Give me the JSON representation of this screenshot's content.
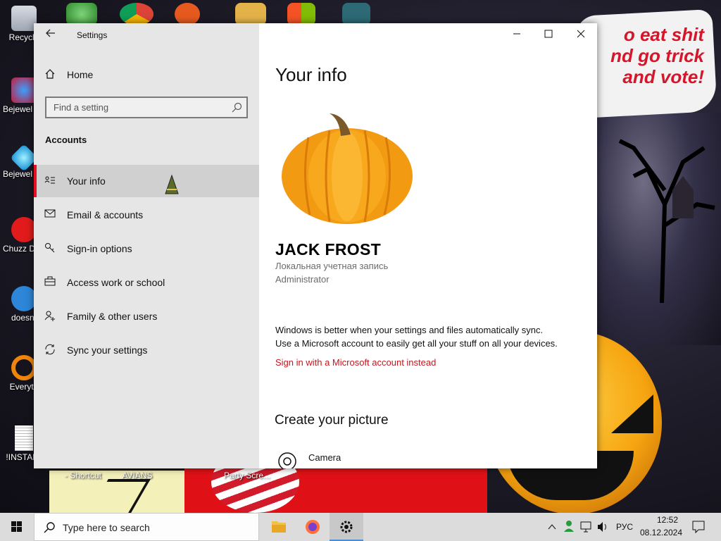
{
  "desktop": {
    "wallpaper_text": [
      "o eat shit",
      "nd go trick",
      "and vote!"
    ],
    "icons": [
      {
        "label": "Recycle"
      },
      {
        "label": "Bejewel Delux"
      },
      {
        "label": "Bejewel Delux"
      },
      {
        "label": "Chuzz Delux"
      },
      {
        "label": "doesnt"
      },
      {
        "label": "Everyth"
      },
      {
        "label": "!INSTALL"
      }
    ],
    "bottom_labels": [
      "- Shortcut",
      "AVIANS",
      "Party Scre..."
    ]
  },
  "window": {
    "title": "Settings",
    "nav": {
      "home_label": "Home",
      "search_placeholder": "Find a setting",
      "section_label": "Accounts",
      "items": [
        {
          "label": "Your info",
          "icon": "person-card-icon",
          "active": true
        },
        {
          "label": "Email & accounts",
          "icon": "mail-icon",
          "active": false
        },
        {
          "label": "Sign-in options",
          "icon": "key-icon",
          "active": false
        },
        {
          "label": "Access work or school",
          "icon": "briefcase-icon",
          "active": false
        },
        {
          "label": "Family & other users",
          "icon": "person-add-icon",
          "active": false
        },
        {
          "label": "Sync your settings",
          "icon": "sync-icon",
          "active": false
        }
      ]
    },
    "content": {
      "title": "Your info",
      "user_name": "JACK FROST",
      "account_type": "Локальная учетная запись",
      "account_role": "Administrator",
      "sync_line_1": "Windows is better when your settings and files automatically sync.",
      "sync_line_2": "Use a Microsoft account to easily get all your stuff on all your devices.",
      "ms_link": "Sign in with a Microsoft account instead",
      "picture_header": "Create your picture",
      "camera_label": "Camera"
    }
  },
  "taskbar": {
    "search_placeholder": "Type here to search",
    "language": "РУС",
    "time": "12:52",
    "date": "08.12.2024"
  },
  "colors": {
    "accent_red": "#e81123",
    "link_red": "#c5161d",
    "nav_bg": "#e6e6e6",
    "taskbar_bg": "#dcdcdc"
  }
}
